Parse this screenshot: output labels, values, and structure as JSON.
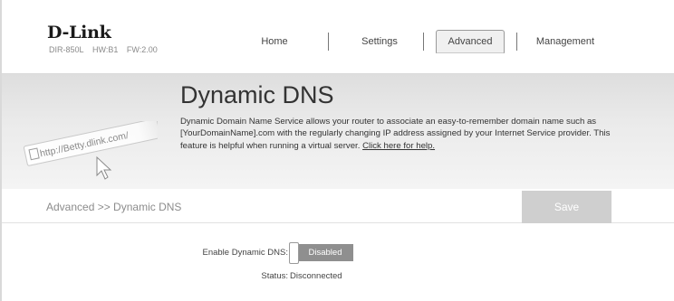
{
  "brand": {
    "logo": "D-Link",
    "model": "DIR-850L",
    "hardware": "HW:B1",
    "firmware": "FW:2.00"
  },
  "nav": {
    "items": [
      {
        "label": "Home",
        "active": false
      },
      {
        "label": "Settings",
        "active": false
      },
      {
        "label": "Advanced",
        "active": true
      },
      {
        "label": "Management",
        "active": false
      }
    ]
  },
  "banner": {
    "title": "Dynamic DNS",
    "description": "Dynamic Domain Name Service allows your router to associate an easy-to-remember domain name such as [YourDomainName].com with the regularly changing IP address assigned by your Internet Service provider. This feature is helpful when running a virtual server.",
    "help_link": "Click here for help.",
    "illustration_url_text": "http://Betty.dlink.com/",
    "illustration_icon": "cursor-arrow-icon"
  },
  "breadcrumb": {
    "text": "Advanced >> Dynamic DNS"
  },
  "toolbar": {
    "save_label": "Save"
  },
  "form": {
    "enable_label": "Enable Dynamic DNS:",
    "enable_value": "Disabled",
    "status_label": "Status:",
    "status_value": "Disconnected"
  },
  "colors": {
    "banner_top": "#dedede",
    "save_button": "#cfcfcf",
    "toggle_off": "#8f8f8f",
    "text": "#333333"
  }
}
